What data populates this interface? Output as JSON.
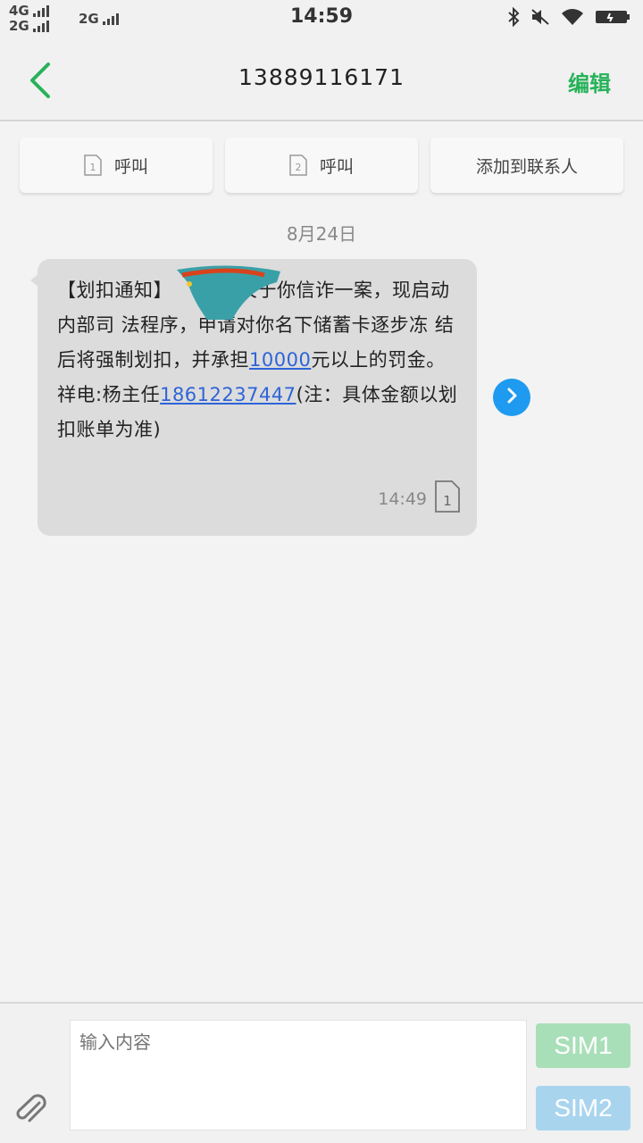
{
  "status_bar": {
    "network1": "4G",
    "network2": "2G",
    "network3": "2G",
    "time": "14:59"
  },
  "header": {
    "title": "13889116171",
    "edit_label": "编辑"
  },
  "actions": {
    "call1_label": "呼叫",
    "call1_sim": "1",
    "call2_label": "呼叫",
    "call2_sim": "2",
    "add_contact_label": "添加到联系人"
  },
  "date_label": "8月24日",
  "message": {
    "seg1": "【划扣通知】",
    "seg2": "关于你信诈一案，现启动内部司 法程序，申请对你名下储蓄卡逐步冻 结后将强制划扣，并承担",
    "amount_link": "10000",
    "seg3": "元以上的罚金。祥电:杨主任",
    "phone_link": "18612237447",
    "seg4": "(注：具体金额以划扣账单为准)",
    "time": "14:49",
    "sim": "1"
  },
  "composer": {
    "placeholder": "输入内容",
    "sim1_label": "SIM1",
    "sim2_label": "SIM2"
  },
  "colors": {
    "accent_green": "#27b25a",
    "link_blue": "#2e64d8",
    "sim1_bg": "#a9dfb8",
    "sim2_bg": "#a9d4ee",
    "forward_blue": "#1e9bf0"
  }
}
